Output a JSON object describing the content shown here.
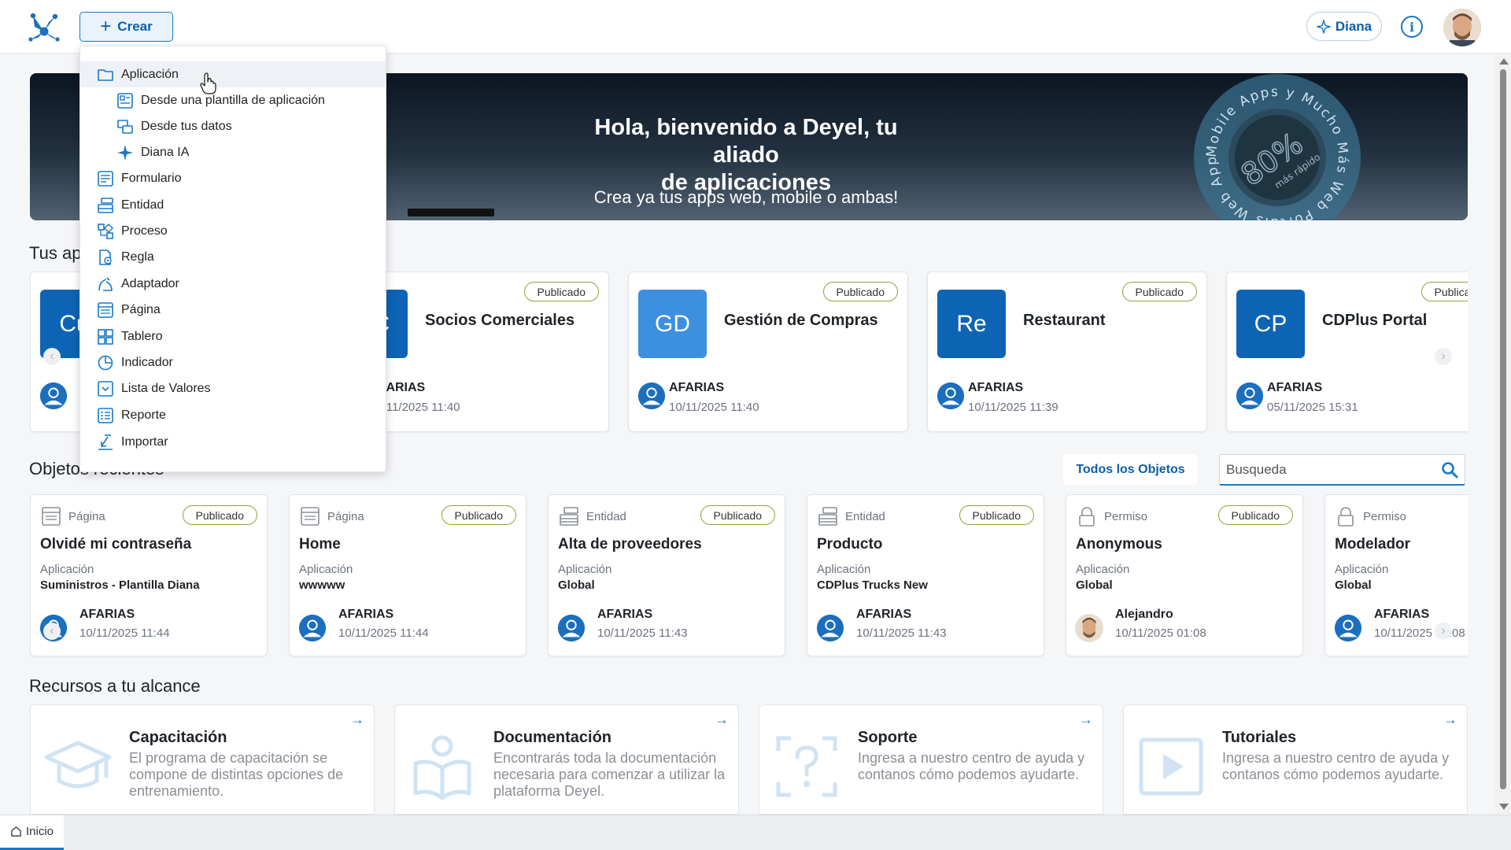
{
  "header": {
    "crear_label": "Crear",
    "diana_label": "Diana",
    "info_label": "i"
  },
  "banner": {
    "title_line1": "Hola, bienvenido a Deyel, tu aliado",
    "title_line2": "de aplicaciones",
    "subtitle": "Crea ya tus apps web, mobile o ambas!",
    "badge_percent": "80%",
    "badge_small": "más rápido",
    "badge_ring_text": "Mobile Apps y Mucho Más Web Portals Web Apps"
  },
  "apps_section": {
    "title": "Tus aplicaciones",
    "cards": [
      {
        "initials": "Cu",
        "name": "",
        "status": "",
        "owner": "",
        "date": ""
      },
      {
        "initials": "SC",
        "name": "Socios Comerciales",
        "status": "Publicado",
        "owner": "AFARIAS",
        "date": "10/11/2025 11:40"
      },
      {
        "initials": "GD",
        "name": "Gestión de Compras",
        "status": "Publicado",
        "owner": "AFARIAS",
        "date": "10/11/2025 11:40"
      },
      {
        "initials": "Re",
        "name": "Restaurant",
        "status": "Publicado",
        "owner": "AFARIAS",
        "date": "10/11/2025 11:39"
      },
      {
        "initials": "CP",
        "name": "CDPlus Portal",
        "status": "Publicado",
        "owner": "AFARIAS",
        "date": "05/11/2025 15:31"
      }
    ]
  },
  "objects_section": {
    "title": "Objetos recientes",
    "all_objects_label": "Todos los Objetos",
    "search_placeholder": "Busqueda",
    "app_label": "Aplicación",
    "cards": [
      {
        "type": "Página",
        "status": "Publicado",
        "name": "Olvidé mi contraseña",
        "app": "Suministros - Plantilla Diana",
        "owner": "AFARIAS",
        "date": "10/11/2025 11:44"
      },
      {
        "type": "Página",
        "status": "Publicado",
        "name": "Home",
        "app": "wwwww",
        "owner": "AFARIAS",
        "date": "10/11/2025 11:44"
      },
      {
        "type": "Entidad",
        "status": "Publicado",
        "name": "Alta de proveedores",
        "app": "Global",
        "owner": "AFARIAS",
        "date": "10/11/2025 11:43"
      },
      {
        "type": "Entidad",
        "status": "Publicado",
        "name": "Producto",
        "app": "CDPlus Trucks New",
        "owner": "AFARIAS",
        "date": "10/11/2025 11:43"
      },
      {
        "type": "Permiso",
        "status": "Publicado",
        "name": "Anonymous",
        "app": "Global",
        "owner": "Alejandro",
        "date": "10/11/2025 01:08"
      },
      {
        "type": "Permiso",
        "status": "",
        "name": "Modelador",
        "app": "Global",
        "owner": "AFARIAS",
        "date": "10/11/2025 01:08"
      }
    ]
  },
  "resources_section": {
    "title": "Recursos a tu alcance",
    "cards": [
      {
        "title": "Capacitación",
        "desc": "El programa de capacitación se compone de distintas opciones de entrenamiento."
      },
      {
        "title": "Documentación",
        "desc": "Encontrarás toda la documentación necesaria para comenzar a utilizar la plataforma Deyel."
      },
      {
        "title": "Soporte",
        "desc": "Ingresa a nuestro centro de ayuda y contanos cómo podemos ayudarte."
      },
      {
        "title": "Tutoriales",
        "desc": "Ingresa a nuestro centro de ayuda y contanos cómo podemos ayudarte."
      }
    ]
  },
  "crear_menu": {
    "items": [
      {
        "label": "Aplicación",
        "icon": "folder-icon"
      },
      {
        "label": "Desde una plantilla de aplicación",
        "icon": "template-icon"
      },
      {
        "label": "Desde tus datos",
        "icon": "data-icon"
      },
      {
        "label": "Diana IA",
        "icon": "sparkle-icon"
      },
      {
        "label": "Formulario",
        "icon": "form-icon"
      },
      {
        "label": "Entidad",
        "icon": "entity-icon"
      },
      {
        "label": "Proceso",
        "icon": "process-icon"
      },
      {
        "label": "Regla",
        "icon": "rule-icon"
      },
      {
        "label": "Adaptador",
        "icon": "adapter-icon"
      },
      {
        "label": "Página",
        "icon": "page-icon"
      },
      {
        "label": "Tablero",
        "icon": "dashboard-icon"
      },
      {
        "label": "Indicador",
        "icon": "indicator-icon"
      },
      {
        "label": "Lista de Valores",
        "icon": "value-list-icon"
      },
      {
        "label": "Reporte",
        "icon": "report-icon"
      },
      {
        "label": "Importar",
        "icon": "import-icon"
      }
    ]
  },
  "bottom_tabs": {
    "home_label": "Inicio"
  },
  "colors": {
    "accent": "#1978c8",
    "tile_dark": "#0e64b4",
    "tile_light": "#3d8fe0",
    "badge_border": "#8ba63a"
  }
}
